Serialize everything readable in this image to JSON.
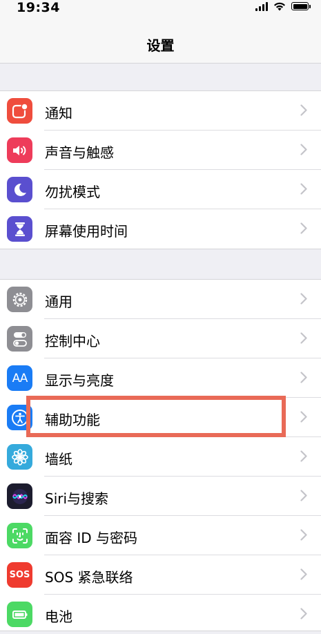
{
  "status_bar": {
    "time": "19:34"
  },
  "nav": {
    "title": "设置"
  },
  "groups": [
    {
      "items": [
        {
          "label": "通知",
          "icon": "notifications-icon",
          "color": "#ef4d3d"
        },
        {
          "label": "声音与触感",
          "icon": "speaker-icon",
          "color": "#ee3c5a"
        },
        {
          "label": "勿扰模式",
          "icon": "moon-icon",
          "color": "#5a4fcf"
        },
        {
          "label": "屏幕使用时间",
          "icon": "hourglass-icon",
          "color": "#5a4fcf"
        }
      ]
    },
    {
      "items": [
        {
          "label": "通用",
          "icon": "gear-icon",
          "color": "#8e8e93"
        },
        {
          "label": "控制中心",
          "icon": "toggles-icon",
          "color": "#8e8e93"
        },
        {
          "label": "显示与亮度",
          "icon": "text-size-icon",
          "color": "#1a7cf5"
        },
        {
          "label": "辅助功能",
          "icon": "accessibility-icon",
          "color": "#1a7cf5"
        },
        {
          "label": "墙纸",
          "icon": "flower-icon",
          "color": "#35aadc"
        },
        {
          "label": "Siri与搜索",
          "icon": "siri-icon",
          "color": "#1c1c2e"
        },
        {
          "label": "面容 ID 与密码",
          "icon": "face-id-icon",
          "color": "#4cd964"
        },
        {
          "label": "SOS 紧急联络",
          "icon": "sos-icon",
          "color": "#ef3b2f"
        },
        {
          "label": "电池",
          "icon": "battery-icon",
          "color": "#4cd964"
        }
      ]
    }
  ],
  "icon_text": {
    "text_size": "AA",
    "sos": "SOS"
  },
  "highlight_color": "#e96a57"
}
